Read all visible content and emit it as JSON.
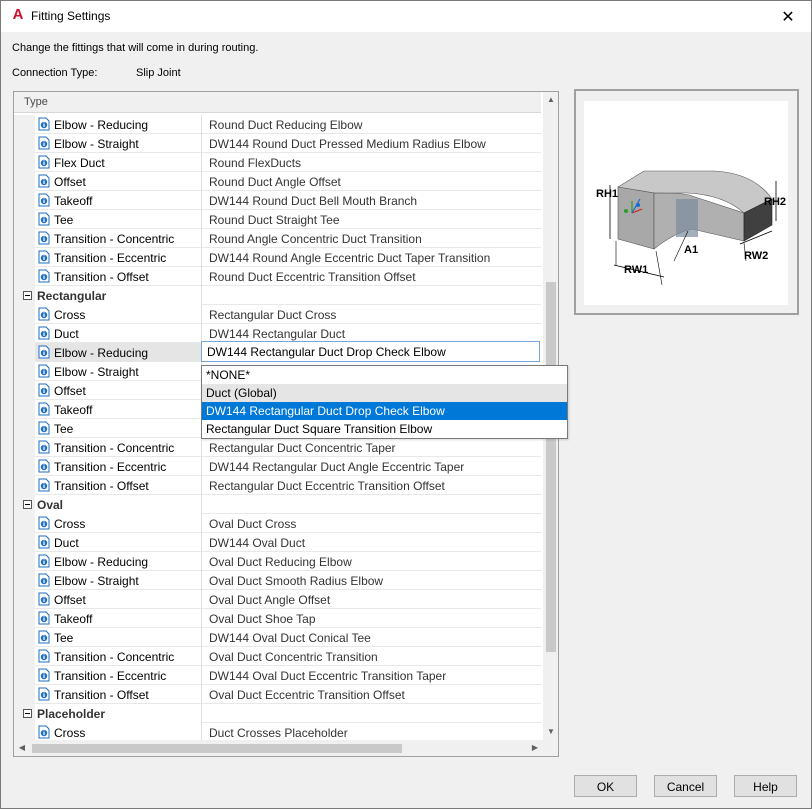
{
  "window": {
    "title": "Fitting Settings",
    "close_glyph": "✕",
    "app_glyph": "A"
  },
  "instruction": "Change the fittings that will come in during routing.",
  "connection": {
    "label": "Connection Type:",
    "value": "Slip Joint"
  },
  "grid": {
    "header": "Type",
    "rows": [
      {
        "kind": "item",
        "name": "Elbow - Reducing",
        "value": "Round Duct Reducing Elbow"
      },
      {
        "kind": "item",
        "name": "Elbow - Straight",
        "value": "DW144 Round Duct Pressed Medium Radius Elbow"
      },
      {
        "kind": "item",
        "name": "Flex Duct",
        "value": "Round FlexDucts"
      },
      {
        "kind": "item",
        "name": "Offset",
        "value": "Round Duct Angle Offset"
      },
      {
        "kind": "item",
        "name": "Takeoff",
        "value": "DW144 Round Duct Bell Mouth Branch"
      },
      {
        "kind": "item",
        "name": "Tee",
        "value": "Round Duct Straight Tee"
      },
      {
        "kind": "item",
        "name": "Transition - Concentric",
        "value": "Round Angle Concentric Duct Transition"
      },
      {
        "kind": "item",
        "name": "Transition - Eccentric",
        "value": "DW144 Round Angle Eccentric Duct Taper Transition"
      },
      {
        "kind": "item",
        "name": "Transition - Offset",
        "value": "Round Duct Eccentric Transition Offset"
      },
      {
        "kind": "cat",
        "name": "Rectangular",
        "value": ""
      },
      {
        "kind": "item",
        "name": "Cross",
        "value": "Rectangular Duct Cross"
      },
      {
        "kind": "item",
        "name": "Duct",
        "value": "DW144 Rectangular Duct"
      },
      {
        "kind": "item",
        "name": "Elbow - Reducing",
        "value": "",
        "selected": true
      },
      {
        "kind": "item",
        "name": "Elbow - Straight",
        "value": ""
      },
      {
        "kind": "item",
        "name": "Offset",
        "value": ""
      },
      {
        "kind": "item",
        "name": "Takeoff",
        "value": ""
      },
      {
        "kind": "item",
        "name": "Tee",
        "value": ""
      },
      {
        "kind": "item",
        "name": "Transition - Concentric",
        "value": "Rectangular Duct Concentric Taper"
      },
      {
        "kind": "item",
        "name": "Transition - Eccentric",
        "value": "DW144 Rectangular Duct Angle Eccentric Taper"
      },
      {
        "kind": "item",
        "name": "Transition - Offset",
        "value": "Rectangular Duct Eccentric Transition Offset"
      },
      {
        "kind": "cat",
        "name": "Oval",
        "value": ""
      },
      {
        "kind": "item",
        "name": "Cross",
        "value": "Oval Duct Cross"
      },
      {
        "kind": "item",
        "name": "Duct",
        "value": "DW144 Oval Duct"
      },
      {
        "kind": "item",
        "name": "Elbow - Reducing",
        "value": "Oval Duct Reducing Elbow"
      },
      {
        "kind": "item",
        "name": "Elbow - Straight",
        "value": "Oval Duct Smooth Radius Elbow"
      },
      {
        "kind": "item",
        "name": "Offset",
        "value": "Oval Duct Angle Offset"
      },
      {
        "kind": "item",
        "name": "Takeoff",
        "value": "Oval Duct Shoe Tap"
      },
      {
        "kind": "item",
        "name": "Tee",
        "value": "DW144 Oval Duct Conical Tee"
      },
      {
        "kind": "item",
        "name": "Transition - Concentric",
        "value": "Oval Duct Concentric Transition"
      },
      {
        "kind": "item",
        "name": "Transition - Eccentric",
        "value": "DW144 Oval Duct Eccentric Transition Taper"
      },
      {
        "kind": "item",
        "name": "Transition - Offset",
        "value": "Oval Duct Eccentric Transition Offset"
      },
      {
        "kind": "cat",
        "name": "Placeholder",
        "value": ""
      },
      {
        "kind": "item",
        "name": "Cross",
        "value": "Duct Crosses Placeholder"
      }
    ]
  },
  "editor": {
    "value": "DW144 Rectangular Duct Drop Check Elbow"
  },
  "dropdown": {
    "options": [
      "*NONE*",
      "Duct (Global)",
      "DW144 Rectangular Duct Drop Check Elbow",
      "Rectangular Duct Square Transition Elbow"
    ],
    "hovered_index": 1,
    "selected_index": 2
  },
  "preview": {
    "labels": {
      "rh1": "RH1",
      "rh2": "RH2",
      "a1": "A1",
      "rw1": "RW1",
      "rw2": "RW2"
    }
  },
  "buttons": {
    "ok": "OK",
    "cancel": "Cancel",
    "help": "Help"
  },
  "colors": {
    "selection": "#0078d7",
    "icon": "#1e6fc2"
  }
}
